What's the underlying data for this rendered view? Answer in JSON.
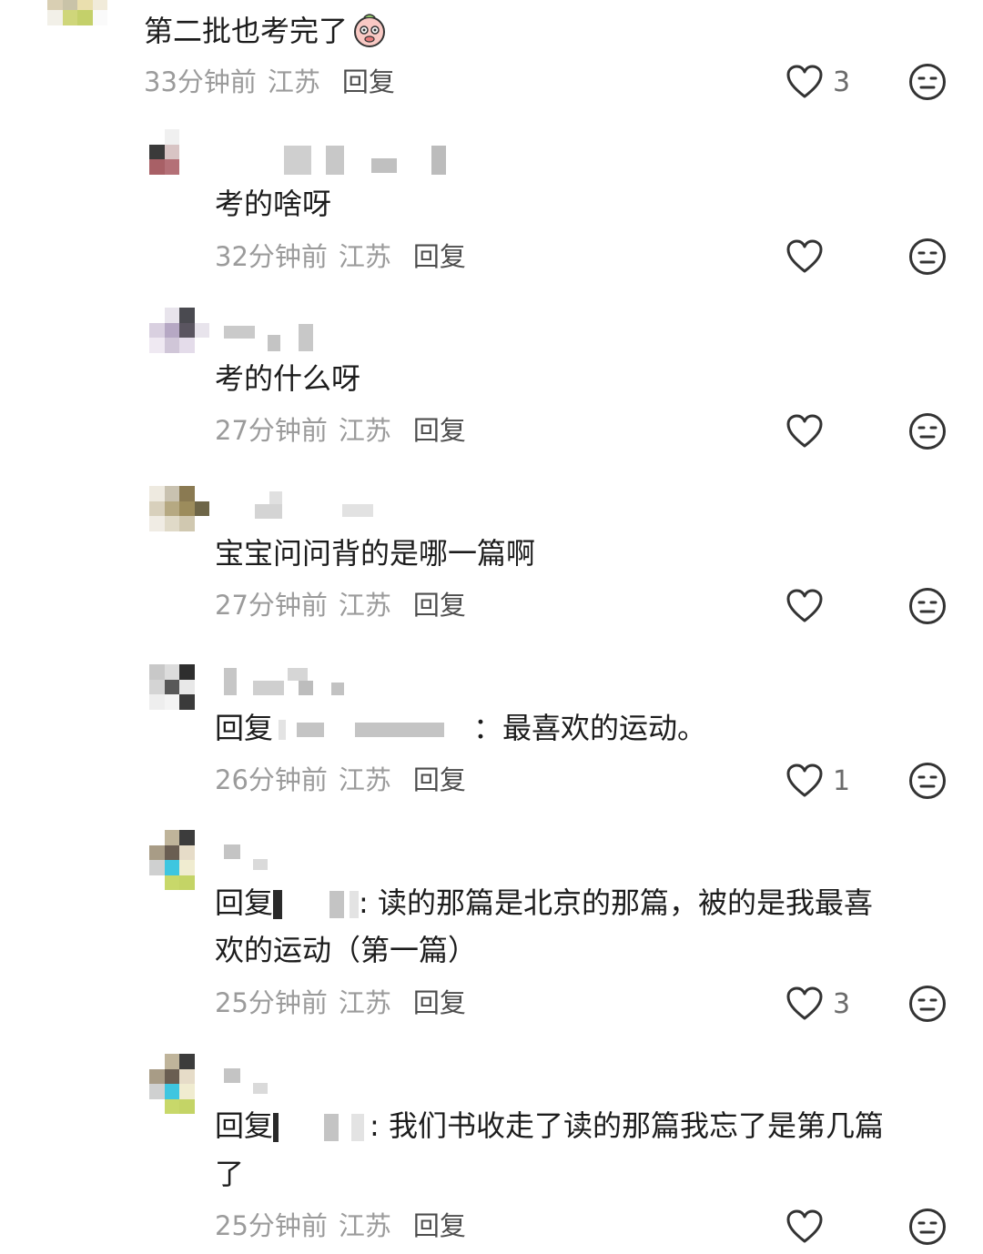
{
  "comments": [
    {
      "text": "第二批也考完了",
      "emoji": "flushed-face-emoji",
      "time": "33分钟前",
      "location": "江苏",
      "reply_label": "回复",
      "likes": "3"
    },
    {
      "text": "考的啥呀",
      "time": "32分钟前",
      "location": "江苏",
      "reply_label": "回复",
      "likes": ""
    },
    {
      "text": "考的什么呀",
      "time": "27分钟前",
      "location": "江苏",
      "reply_label": "回复",
      "likes": ""
    },
    {
      "text": "宝宝问问背的是哪一篇啊",
      "time": "27分钟前",
      "location": "江苏",
      "reply_label": "回复",
      "likes": ""
    },
    {
      "reply_prefix": "回复",
      "text": "：最喜欢的运动。",
      "time": "26分钟前",
      "location": "江苏",
      "reply_label": "回复",
      "likes": "1"
    },
    {
      "reply_prefix": "回复",
      "text": ": 读的那篇是北京的那篇，被的是我最喜",
      "text2": "欢的运动（第一篇）",
      "time": "25分钟前",
      "location": "江苏",
      "reply_label": "回复",
      "likes": "3"
    },
    {
      "reply_prefix": "回复",
      "text": ": 我们书收走了读的那篇我忘了是第几篇",
      "text2": "了",
      "time": "25分钟前",
      "location": "江苏",
      "reply_label": "回复",
      "likes": ""
    }
  ],
  "icons": {
    "like": "heart-outline-icon",
    "dislike": "neutral-face-icon"
  },
  "colors": {
    "meta": "#9b9b9b",
    "icon": "#333333"
  }
}
